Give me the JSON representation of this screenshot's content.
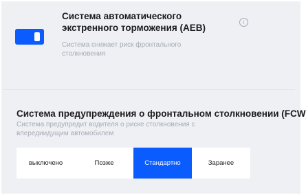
{
  "aeb": {
    "enabled": true,
    "title": "Система автоматического экстренного торможения (AEB)",
    "description": "Система снижает риск фронтального столкновения",
    "info_icon": "info-circle-icon",
    "info_glyph": "i"
  },
  "fcw": {
    "title": "Система предупреждения о фронтальном столкновении (FCW)",
    "description": "Система предупредит водителя о риске столкновения с впередиидущим автомобилем",
    "options": [
      {
        "label": "выключено",
        "selected": false
      },
      {
        "label": "Позже",
        "selected": false
      },
      {
        "label": "Стандартно",
        "selected": true
      },
      {
        "label": "Заранее",
        "selected": false
      }
    ]
  },
  "colors": {
    "accent": "#0a5cff",
    "panel_bg": "#eef0f4",
    "secondary_text": "#a6acb6"
  }
}
